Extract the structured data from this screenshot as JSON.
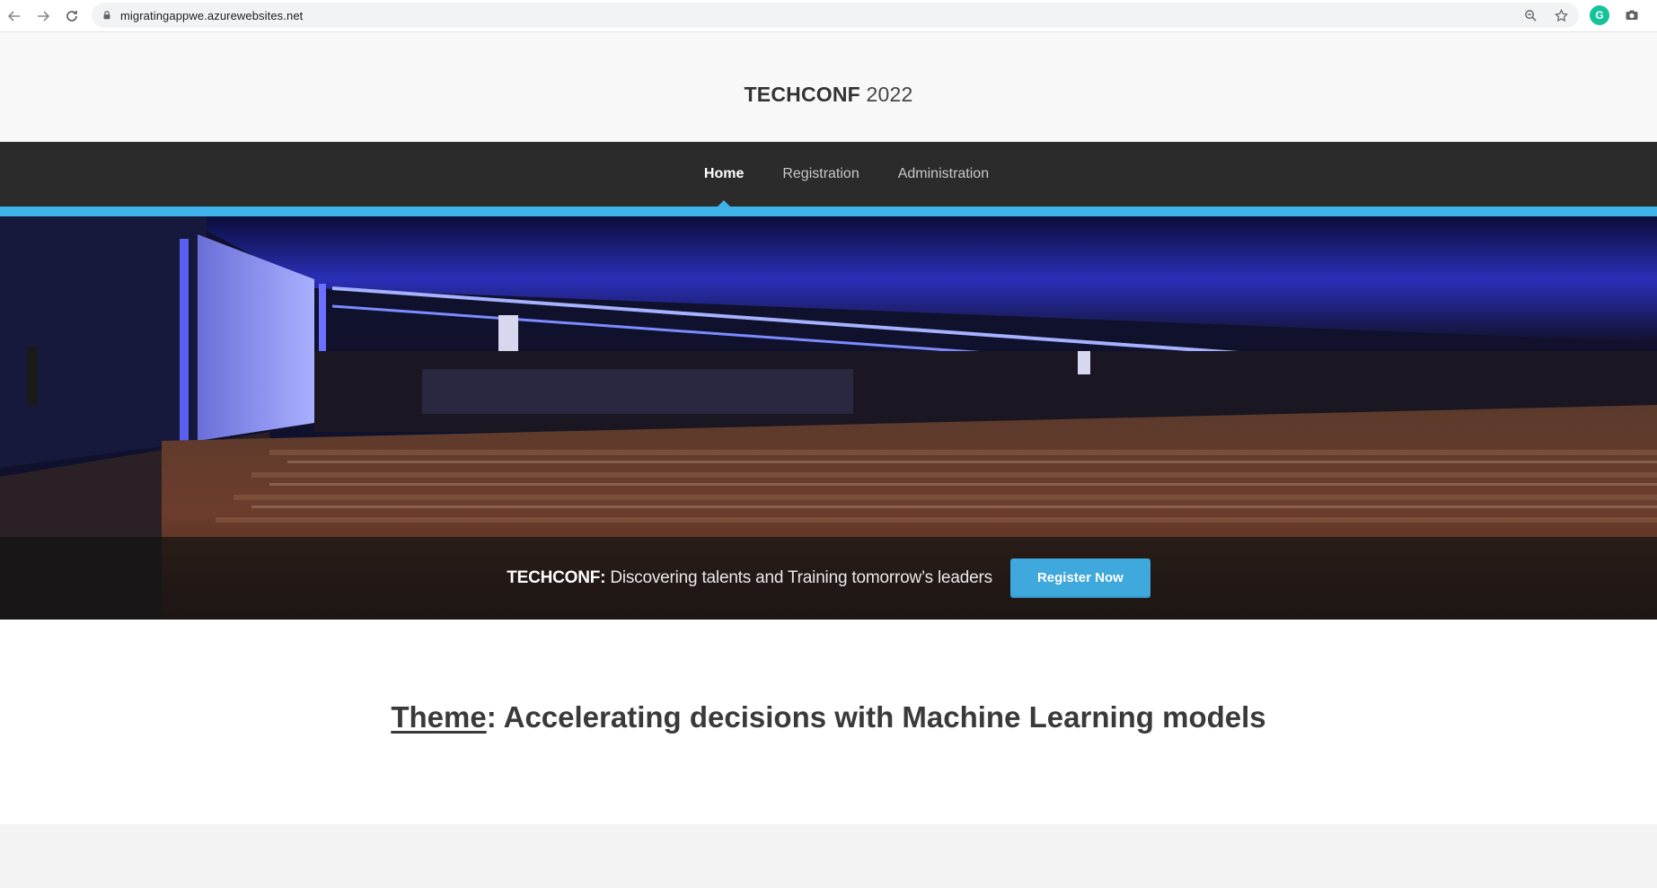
{
  "browser": {
    "url": "migratingappwe.azurewebsites.net"
  },
  "header": {
    "brand_strong": "TECHCONF",
    "brand_light": " 2022"
  },
  "nav": {
    "items": [
      {
        "label": "Home",
        "active": true
      },
      {
        "label": "Registration",
        "active": false
      },
      {
        "label": "Administration",
        "active": false
      }
    ]
  },
  "hero": {
    "tagline_bold": "TECHCONF:",
    "tagline_rest": " Discovering talents and Training tomorrow’s leaders",
    "button_label": "Register Now"
  },
  "theme": {
    "label": "Theme",
    "text": ": Accelerating decisions with Machine Learning models"
  },
  "colors": {
    "accent": "#3fb3e9",
    "nav_bg": "#2b2b2b",
    "button": "#3fa8dc"
  }
}
